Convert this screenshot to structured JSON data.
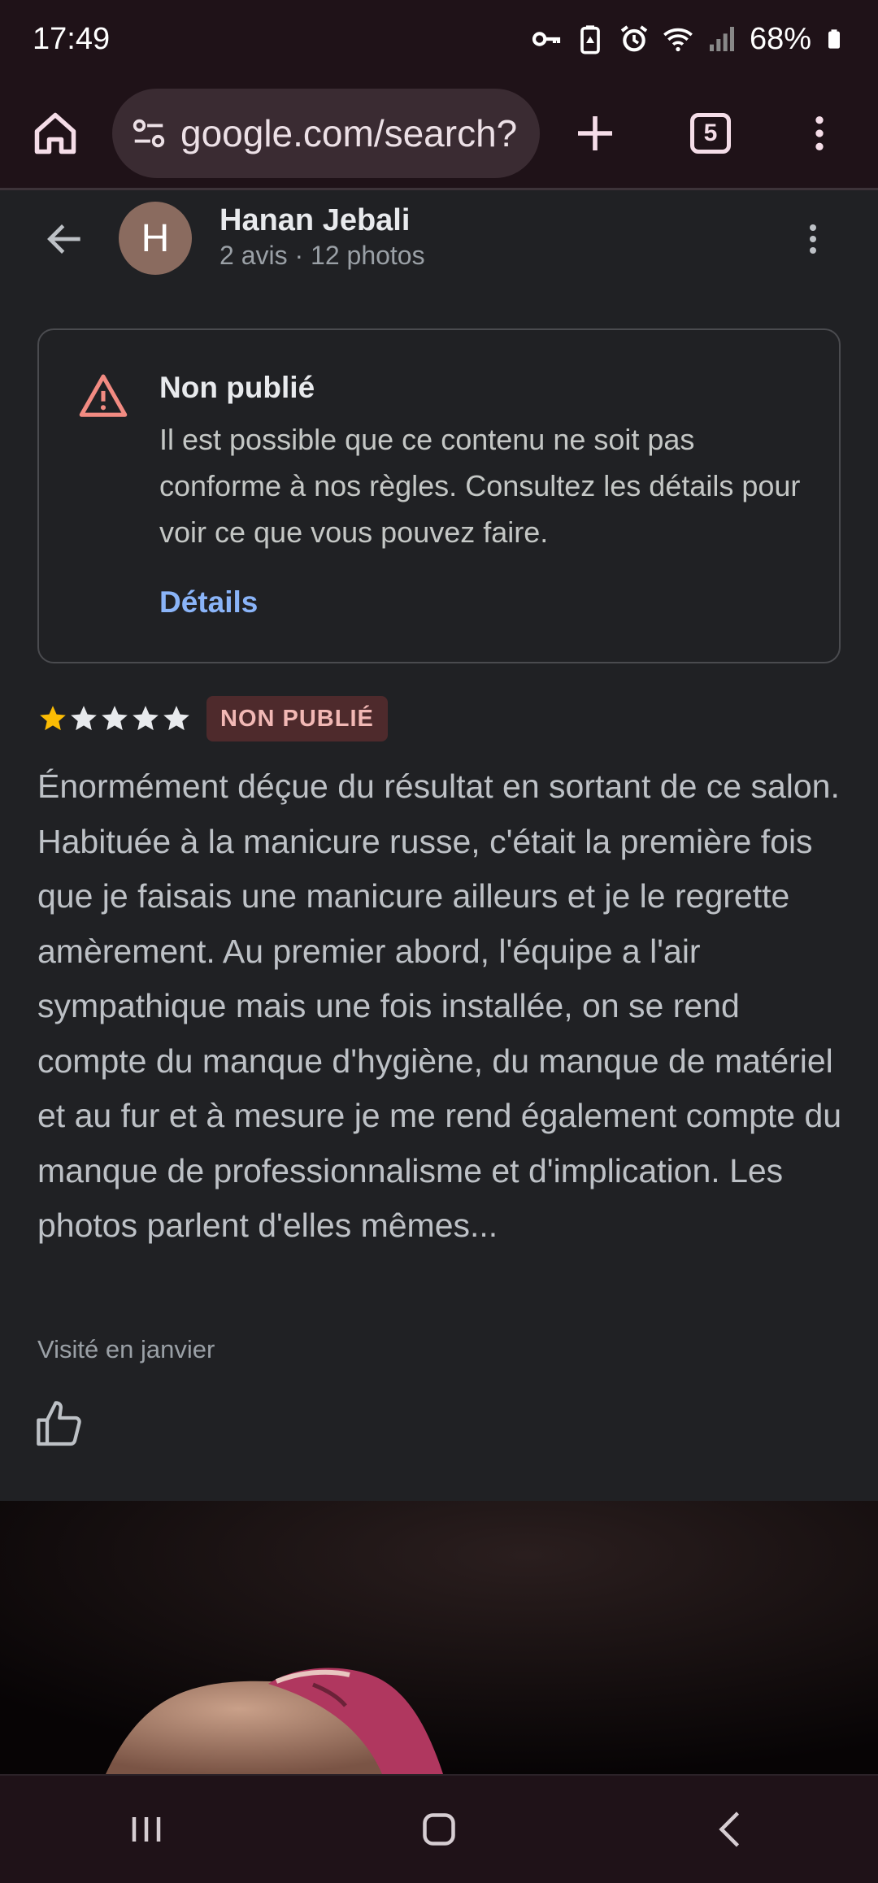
{
  "status_bar": {
    "time": "17:49",
    "battery": "68%",
    "icons": [
      "key-icon",
      "battery-saver-icon",
      "alarm-icon",
      "wifi-icon",
      "signal-icon",
      "battery-icon"
    ]
  },
  "browser": {
    "url": "google.com/search?",
    "tab_count": "5",
    "icons": [
      "home-icon",
      "site-settings-icon",
      "new-tab-icon",
      "tabs-icon",
      "menu-icon"
    ]
  },
  "reviewer": {
    "initial": "H",
    "name": "Hanan Jebali",
    "meta": "2 avis · 12 photos",
    "avatar_color": "#8a6b5f"
  },
  "warning": {
    "title": "Non publié",
    "text": "Il est possible que ce contenu ne soit pas conforme à nos règles. Consultez les détails pour voir ce que vous pouvez faire.",
    "link": "Détails",
    "icon_color": "#f28b82",
    "link_color": "#8ab4f8"
  },
  "review": {
    "rating": 1,
    "max_rating": 5,
    "badge": "NON PUBLIÉ",
    "body": "Énormément déçue du résultat en sortant de ce salon. Habituée à la manicure russe, c'était la première fois que je faisais une manicure ailleurs et je le regrette amèrement. Au premier abord, l'équipe a l'air sympathique mais une fois installée, on se rend compte du manque d'hygiène, du manque de matériel et au fur et à mesure je me rend également compte du manque de professionnalisme et d'implication. Les photos parlent d'elles mêmes...",
    "visited": "Visité en janvier",
    "star_color": "#fbbc04"
  },
  "nav": {
    "icons": [
      "recents-icon",
      "home-nav-icon",
      "back-nav-icon"
    ]
  }
}
